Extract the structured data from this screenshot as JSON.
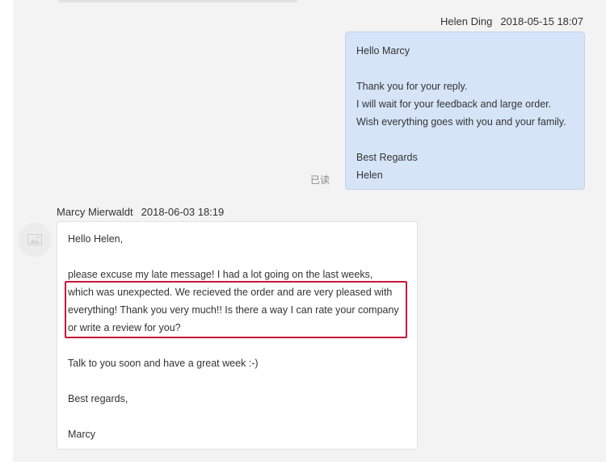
{
  "outgoing": {
    "sender": "Helen Ding",
    "timestamp": "2018-05-15 18:07",
    "lines": [
      "Hello Marcy",
      "",
      "Thank you for your reply.",
      "I will wait for your feedback and large order.",
      "Wish everything goes with you and your family.",
      "",
      "Best Regards",
      "Helen"
    ],
    "read_status": "已读"
  },
  "incoming": {
    "sender": "Marcy Mierwaldt",
    "timestamp": "2018-06-03 18:19",
    "avatar_icon": "image-placeholder-icon",
    "lines": [
      "Hello Helen,",
      "",
      "please excuse my late message! I had a lot going on the last weeks,",
      "which was unexpected. We recieved the order and are very pleased with",
      "everything! Thank you very much!! Is there a way I can rate your company",
      "or write a review for you?",
      "",
      "Talk to you soon and have a great week :-)",
      "",
      "Best regards,",
      "",
      "Marcy"
    ]
  },
  "colors": {
    "outgoing_bubble": "#d6e4f8",
    "highlight_border": "#c4183c",
    "panel_background": "#f3f3f3"
  }
}
